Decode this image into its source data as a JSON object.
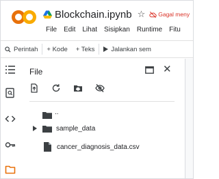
{
  "window": {
    "notebook_name": "Blockchain.ipynb",
    "warning_text": "Gagal meny"
  },
  "menu": {
    "items": [
      "File",
      "Edit",
      "Lihat",
      "Sisipkan",
      "Runtime",
      "Fitu"
    ]
  },
  "toolbar": {
    "command_label": "Perintah",
    "code_label": "+ Kode",
    "text_label": "+ Teks",
    "run_label": "Jalankan sem"
  },
  "file_panel": {
    "title": "File",
    "parent_label": "..",
    "items": [
      {
        "name": "sample_data",
        "type": "folder"
      },
      {
        "name": "cancer_diagnosis_data.csv",
        "type": "file"
      }
    ]
  },
  "colors": {
    "colab_orange": "#f9ab00",
    "colab_orange_dark": "#e8710a",
    "warning_red": "#d93025",
    "folder": "#3c4043"
  }
}
